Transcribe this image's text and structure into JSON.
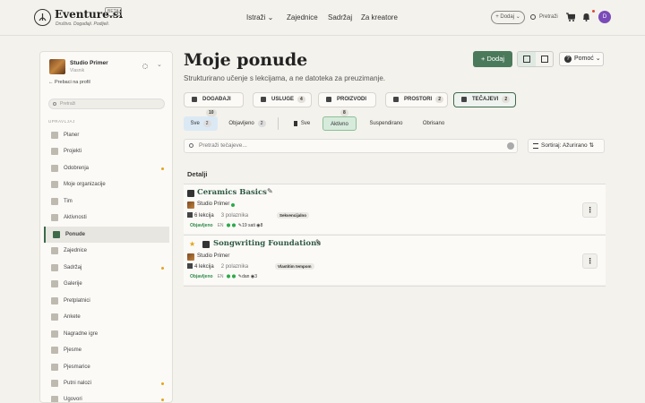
{
  "header": {
    "brand": "Eventure.si",
    "beta": "BETA",
    "tagline": "Društvo. Događaji. Podijeli.",
    "nav": [
      "Istraži",
      "Zajednice",
      "Sadržaj",
      "Za kreatore"
    ],
    "add_label": "+ Dodaj",
    "search_label": "Pretraži",
    "avatar_initial": "D"
  },
  "sidebar": {
    "org_name": "Studio Primer",
    "org_sub": "Vlasnik",
    "back_link": "← Prebaci na profil",
    "search_placeholder": "Pretraži",
    "section": "UPRAVLJAJ",
    "items": [
      {
        "label": "Planer",
        "dot": false
      },
      {
        "label": "Projekti",
        "dot": false
      },
      {
        "label": "Odobrenja",
        "dot": true
      },
      {
        "label": "Moje organizacije",
        "dot": false
      },
      {
        "label": "Tim",
        "dot": false
      },
      {
        "label": "Aktivnosti",
        "dot": false
      },
      {
        "label": "Ponude",
        "dot": false,
        "active": true
      },
      {
        "label": "Zajednice",
        "dot": false
      },
      {
        "label": "Sadržaj",
        "dot": true
      },
      {
        "label": "Galerije",
        "dot": false
      },
      {
        "label": "Pretplatnici",
        "dot": false
      },
      {
        "label": "Ankete",
        "dot": false
      },
      {
        "label": "Nagradne igre",
        "dot": false
      },
      {
        "label": "Pjesme",
        "dot": false
      },
      {
        "label": "Pjesmarice",
        "dot": false
      },
      {
        "label": "Putni nalozi",
        "dot": true
      },
      {
        "label": "Ugovori",
        "dot": true
      }
    ]
  },
  "main": {
    "title": "Moje ponude",
    "subtitle": "Strukturirano učenje s lekcijama, a ne datoteka za preuzimanje.",
    "add_button": "Dodaj",
    "help_button": "Pomoć",
    "tabs": [
      {
        "label": "DOGAĐAJI",
        "count": "10"
      },
      {
        "label": "USLUGE",
        "count": "4"
      },
      {
        "label": "PROIZVODI",
        "count": "8"
      },
      {
        "label": "PROSTORI",
        "count": "2"
      },
      {
        "label": "TEČAJEVI",
        "count": "2",
        "active": true
      }
    ],
    "filters": {
      "sve": "Sve",
      "sve_count": "2",
      "objavljeno": "Objavljeno",
      "objavljeno_count": "2",
      "status_all": "Sve",
      "aktivno": "Aktivno",
      "suspendirano": "Suspendirano",
      "obrisano": "Obrisano"
    },
    "search_placeholder": "Pretraži tečajeve...",
    "sort_label": "Sortiraj: Ažurirano",
    "list_header": "Detalji",
    "courses": [
      {
        "title": "Ceramics Basics",
        "org": "Studio Primer",
        "lessons": "6 lekcija",
        "participants": "3 polaznika",
        "badge": "Sekvencijalno",
        "status": "Objavljeno",
        "lang": "EN",
        "duration": "19 sati",
        "views": "8",
        "starred": false
      },
      {
        "title": "Songwriting Foundations",
        "org": "Studio Primer",
        "lessons": "4 lekcija",
        "participants": "2 polaznika",
        "badge": "Vlastitim tempom",
        "status": "Objavljeno",
        "lang": "EN",
        "duration": "dan",
        "views": "3",
        "starred": true
      }
    ]
  }
}
